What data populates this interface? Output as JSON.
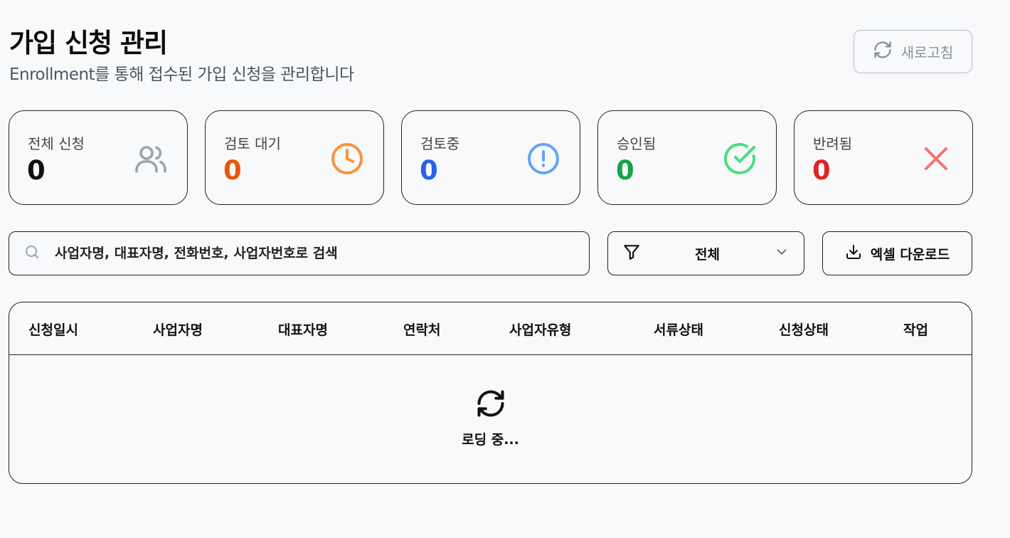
{
  "header": {
    "title": "가입 신청 관리",
    "subtitle": "Enrollment를 통해 접수된 가입 신청을 관리합니다",
    "refresh_label": "새로고침"
  },
  "stats": [
    {
      "label": "전체 신청",
      "value": "0",
      "color": "#111111",
      "icon": "users-icon"
    },
    {
      "label": "검토 대기",
      "value": "0",
      "color": "#e8580c",
      "icon": "clock-icon"
    },
    {
      "label": "검토중",
      "value": "0",
      "color": "#2563eb",
      "icon": "alert-circle-icon"
    },
    {
      "label": "승인됨",
      "value": "0",
      "color": "#16a34a",
      "icon": "check-circle-icon"
    },
    {
      "label": "반려됨",
      "value": "0",
      "color": "#dc2626",
      "icon": "x-icon"
    }
  ],
  "toolbar": {
    "search_placeholder": "사업자명, 대표자명, 전화번호, 사업자번호로 검색",
    "filter_value": "전체",
    "excel_label": "엑셀 다운로드"
  },
  "table": {
    "columns": [
      "신청일시",
      "사업자명",
      "대표자명",
      "연락처",
      "사업자유형",
      "서류상태",
      "신청상태",
      "작업"
    ],
    "loading_text": "로딩 중..."
  }
}
